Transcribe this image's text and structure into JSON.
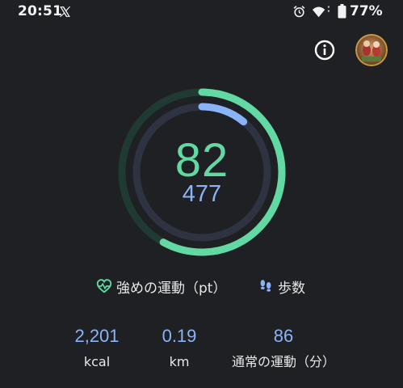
{
  "status_bar": {
    "time": "20:51",
    "battery": "77%",
    "icons": [
      "x-logo-icon",
      "alarm-icon",
      "wifi-icon",
      "battery-icon"
    ]
  },
  "header": {
    "icons": [
      "info-icon",
      "avatar"
    ]
  },
  "ring": {
    "heart_points": "82",
    "steps": "477",
    "heart_points_progress": 0.58,
    "steps_progress": 0.11,
    "colors": {
      "heart_points": "#62d9a3",
      "steps": "#8ab4f8",
      "track_outer": "#1f3a33",
      "track_inner": "#2f3240"
    }
  },
  "legend": {
    "heart_points_label": "強めの運動（pt）",
    "steps_label": "歩数"
  },
  "stats": {
    "calories_value": "2,201",
    "calories_label": "kcal",
    "distance_value": "0.19",
    "distance_label": "km",
    "move_minutes_value": "86",
    "move_minutes_label": "通常の運動（分）"
  }
}
